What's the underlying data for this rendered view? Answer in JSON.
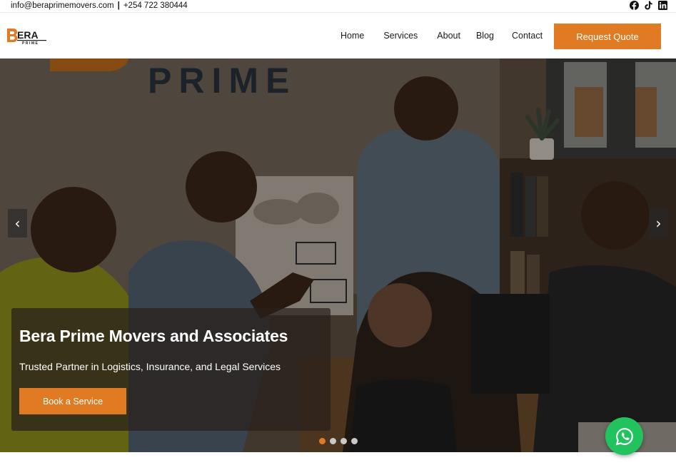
{
  "topbar": {
    "email": "info@beraprimemovers.com",
    "separator": "|",
    "phone": "+254 722 380444",
    "social_icons": [
      "facebook-icon",
      "tiktok-icon",
      "linkedin-icon"
    ]
  },
  "header": {
    "logo_text": "BERA",
    "logo_subtext": "PRIME",
    "nav": [
      {
        "label": "Home"
      },
      {
        "label": "Services"
      },
      {
        "label": "About"
      },
      {
        "label": "Blog"
      },
      {
        "label": "Contact"
      }
    ],
    "cta_label": "Request Quote"
  },
  "hero": {
    "wall_sign": "PRIME",
    "title": "Bera Prime Movers and Associates",
    "subtitle": "Trusted Partner in Logistics, Insurance, and Legal Services",
    "button_label": "Book a Service",
    "prev_arrow": "‹",
    "next_arrow": "›",
    "slide_count": 4,
    "active_slide": 1
  },
  "floating": {
    "whatsapp_icon": "whatsapp-icon"
  },
  "colors": {
    "accent": "#e07b24",
    "whatsapp": "#22c35e",
    "text_dark": "#1a1a1a"
  }
}
